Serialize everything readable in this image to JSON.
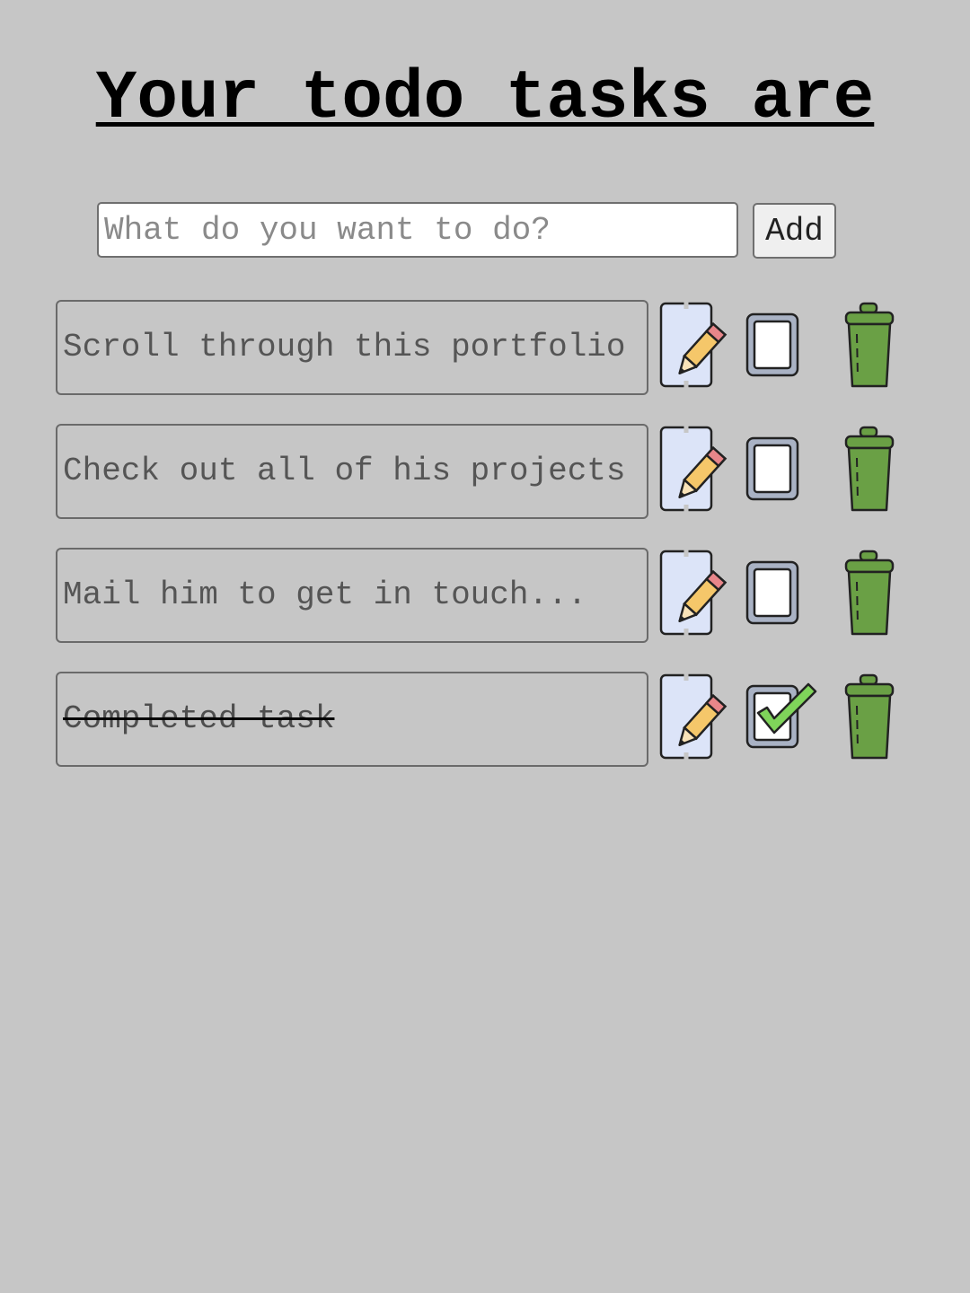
{
  "header": {
    "title": "Your todo tasks are"
  },
  "add_form": {
    "placeholder": "What do you want to do?",
    "value": "",
    "add_label": "Add"
  },
  "tasks": [
    {
      "text": "Scroll through this portfolio",
      "completed": false
    },
    {
      "text": "Check out all of his projects",
      "completed": false
    },
    {
      "text": "Mail him to get in touch...",
      "completed": false
    },
    {
      "text": "Completed task",
      "completed": true
    }
  ],
  "icons": {
    "edit": "pencil-icon",
    "toggle": "checkbox-icon",
    "delete": "trash-icon"
  },
  "colors": {
    "background": "#c6c6c6",
    "trash_green": "#6aa045",
    "check_green": "#7fd45a",
    "pencil_yellow": "#f5c76a",
    "pencil_pink": "#e8868a",
    "notepad_blue": "#dce4f8",
    "checkbox_frame": "#a9b2c4"
  }
}
